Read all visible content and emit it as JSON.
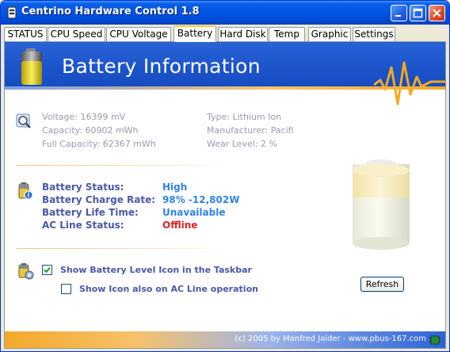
{
  "window": {
    "title": "Centrino Hardware Control 1.8"
  },
  "tabs": [
    {
      "label": "STATUS"
    },
    {
      "label": "CPU Speed"
    },
    {
      "label": "CPU Voltage"
    },
    {
      "label": "Battery"
    },
    {
      "label": "Hard Disk"
    },
    {
      "label": "Temp"
    },
    {
      "label": "Graphic"
    },
    {
      "label": "Settings"
    }
  ],
  "active_tab": "Battery",
  "banner": {
    "title": "Battery Information"
  },
  "info": {
    "voltage": "Voltage:  16399 mV",
    "capacity": "Capacity:  60902 mWh",
    "full_capacity": "Full Capacity:  62367 mWh",
    "type": "Type:  Lithium Ion",
    "manufacturer": "Manufacturer:  Pacifi",
    "wear_level": "Wear Level:  2 %"
  },
  "status": {
    "battery_status_label": "Battery Status:",
    "battery_status_value": "High",
    "charge_rate_label": "Battery Charge Rate:",
    "charge_rate_value": "98%  -12,802W",
    "life_time_label": "Battery Life Time:",
    "life_time_value": "Unavailable",
    "ac_line_label": "AC Line Status:",
    "ac_line_value": "Offline"
  },
  "options": {
    "show_taskbar_icon_label": "Show Battery Level Icon in the Taskbar",
    "show_taskbar_icon_checked": true,
    "show_ac_icon_label": "Show Icon also on AC Line operation",
    "show_ac_icon_checked": false
  },
  "buttons": {
    "refresh": "Refresh"
  },
  "footer": {
    "text": "(c) 2005 by Manfred Jaider  -  www.pbus-167.com"
  },
  "colors": {
    "value_blue": "#2f84e6",
    "value_red": "#e02020",
    "label_blue": "#4a58a8"
  }
}
